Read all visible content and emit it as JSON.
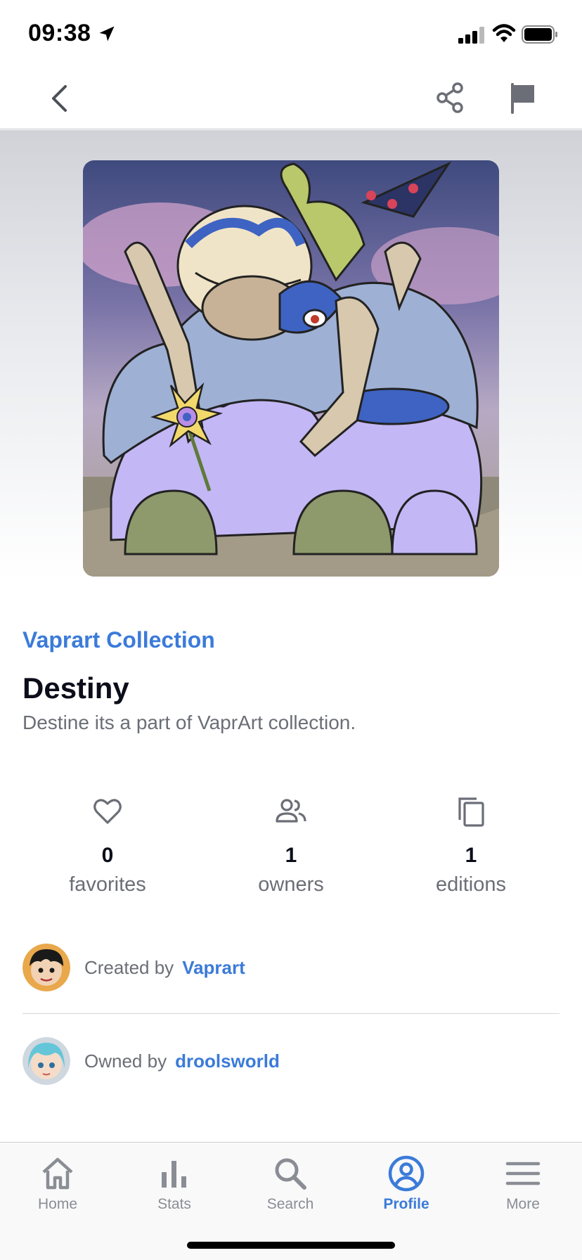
{
  "status_bar": {
    "time": "09:38"
  },
  "nav": {
    "back_icon": "chevron-left-icon",
    "share_icon": "share-icon",
    "flag_icon": "flag-icon"
  },
  "artwork": {
    "description_icon": "artwork-image"
  },
  "item": {
    "collection": "Vaprart Collection",
    "title": "Destiny",
    "description": "Destine its a part of VaprArt collection."
  },
  "stats": [
    {
      "icon": "heart-icon",
      "value": "0",
      "label": "favorites"
    },
    {
      "icon": "people-icon",
      "value": "1",
      "label": "owners"
    },
    {
      "icon": "copy-icon",
      "value": "1",
      "label": "editions"
    }
  ],
  "creator": {
    "prefix": "Created by",
    "name": "Vaprart"
  },
  "owner": {
    "prefix": "Owned by",
    "name": "droolsworld"
  },
  "tabs": [
    {
      "label": "Home",
      "icon": "home-icon",
      "active": false
    },
    {
      "label": "Stats",
      "icon": "bar-chart-icon",
      "active": false
    },
    {
      "label": "Search",
      "icon": "search-icon",
      "active": false
    },
    {
      "label": "Profile",
      "icon": "profile-icon",
      "active": true
    },
    {
      "label": "More",
      "icon": "menu-icon",
      "active": false
    }
  ],
  "colors": {
    "accent": "#3b7bd9",
    "muted": "#8a8d94",
    "text": "#0b0d1a"
  }
}
